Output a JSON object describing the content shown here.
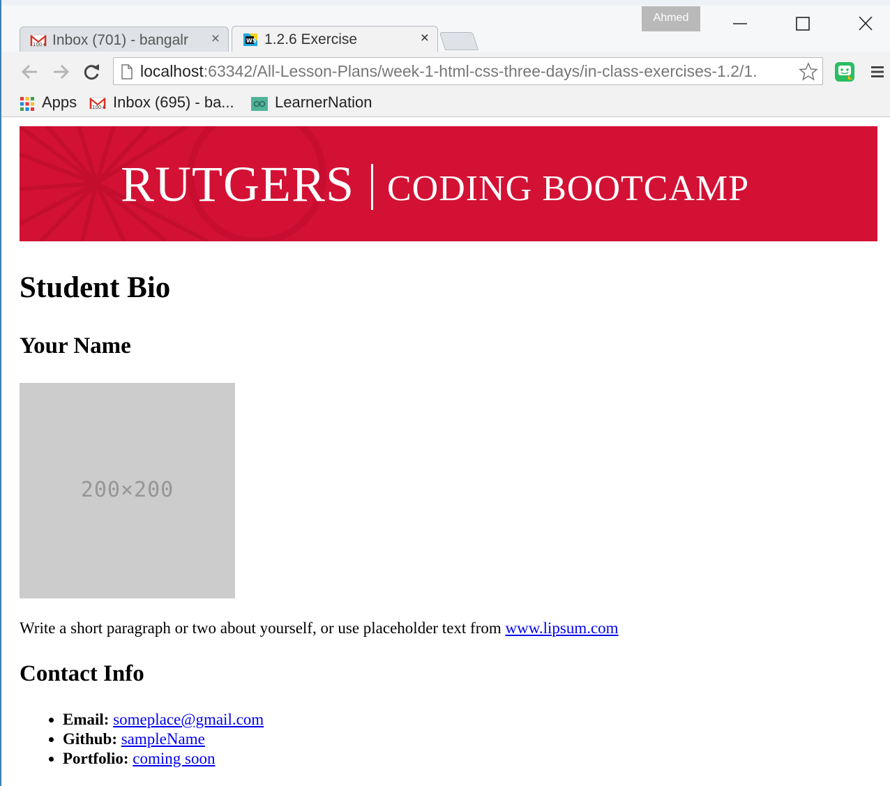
{
  "browser": {
    "profile_name": "Ahmed",
    "tabs": [
      {
        "title": "Inbox (701) - bangalr",
        "close": "×",
        "favicon": "gmail-icon"
      },
      {
        "title": "1.2.6 Exercise",
        "close": "×",
        "favicon": "webstorm-icon"
      }
    ],
    "url_host": "localhost",
    "url_rest": ":63342/All-Lesson-Plans/week-1-html-css-three-days/in-class-exercises-1.2/1.",
    "bookmarks": [
      {
        "label": "Apps",
        "icon": "apps-grid-icon"
      },
      {
        "label": "Inbox (695) - ba...",
        "icon": "gmail-icon"
      },
      {
        "label": "LearnerNation",
        "icon": "learnernation-icon"
      }
    ]
  },
  "banner": {
    "brand_main": "RUTGERS",
    "brand_sub": "CODING BOOTCAMP",
    "color": "#d31134"
  },
  "page": {
    "title": "Student Bio",
    "name_heading": "Your Name",
    "image_placeholder": "200×200",
    "bio_text": "Write a short paragraph or two about yourself, or use placeholder text from ",
    "bio_link": "www.lipsum.com",
    "contact_heading": "Contact Info",
    "contact": [
      {
        "label": "Email:",
        "value": "someplace@gmail.com"
      },
      {
        "label": "Github:",
        "value": "sampleName"
      },
      {
        "label": "Portfolio:",
        "value": "coming soon"
      }
    ]
  }
}
